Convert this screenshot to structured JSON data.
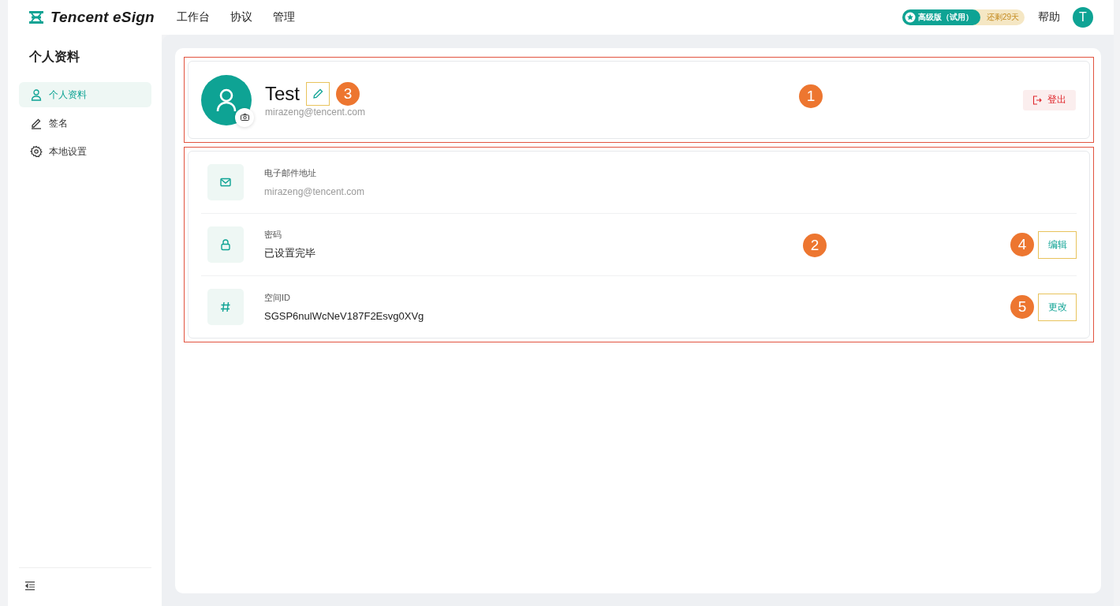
{
  "topbar": {
    "brand": "Tencent eSign",
    "nav": [
      {
        "label": "工作台",
        "selected": false
      },
      {
        "label": "协议",
        "selected": false
      },
      {
        "label": "管理",
        "selected": false
      }
    ],
    "plan": {
      "label": "高级版（试用）",
      "remaining": "还剩29天"
    },
    "help": "帮助",
    "avatar": "T"
  },
  "sidebar": {
    "title": "个人资料",
    "items": [
      {
        "label": "个人资料",
        "selected": true
      },
      {
        "label": "签名",
        "selected": false
      },
      {
        "label": "本地设置",
        "selected": false
      }
    ]
  },
  "profile": {
    "name": "Test",
    "email": "mirazeng@tencent.com",
    "edit_highlighted": true,
    "logout": "登出",
    "callouts": [
      "3",
      "1"
    ]
  },
  "account": {
    "callout": "2",
    "rows": [
      {
        "label": "电子邮件地址",
        "value": "mirazeng@tencent.com",
        "blurred": true
      },
      {
        "label": "密码",
        "value": "已设置完毕",
        "blurred": false,
        "action": "编辑",
        "action_highlighted": true,
        "callout": "4"
      },
      {
        "label": "空间ID",
        "value": "SGSP6nulWcNeV187F2Esvg0XVg",
        "blurred": false,
        "action": "更改",
        "action_highlighted": true,
        "callout": "5"
      }
    ]
  }
}
